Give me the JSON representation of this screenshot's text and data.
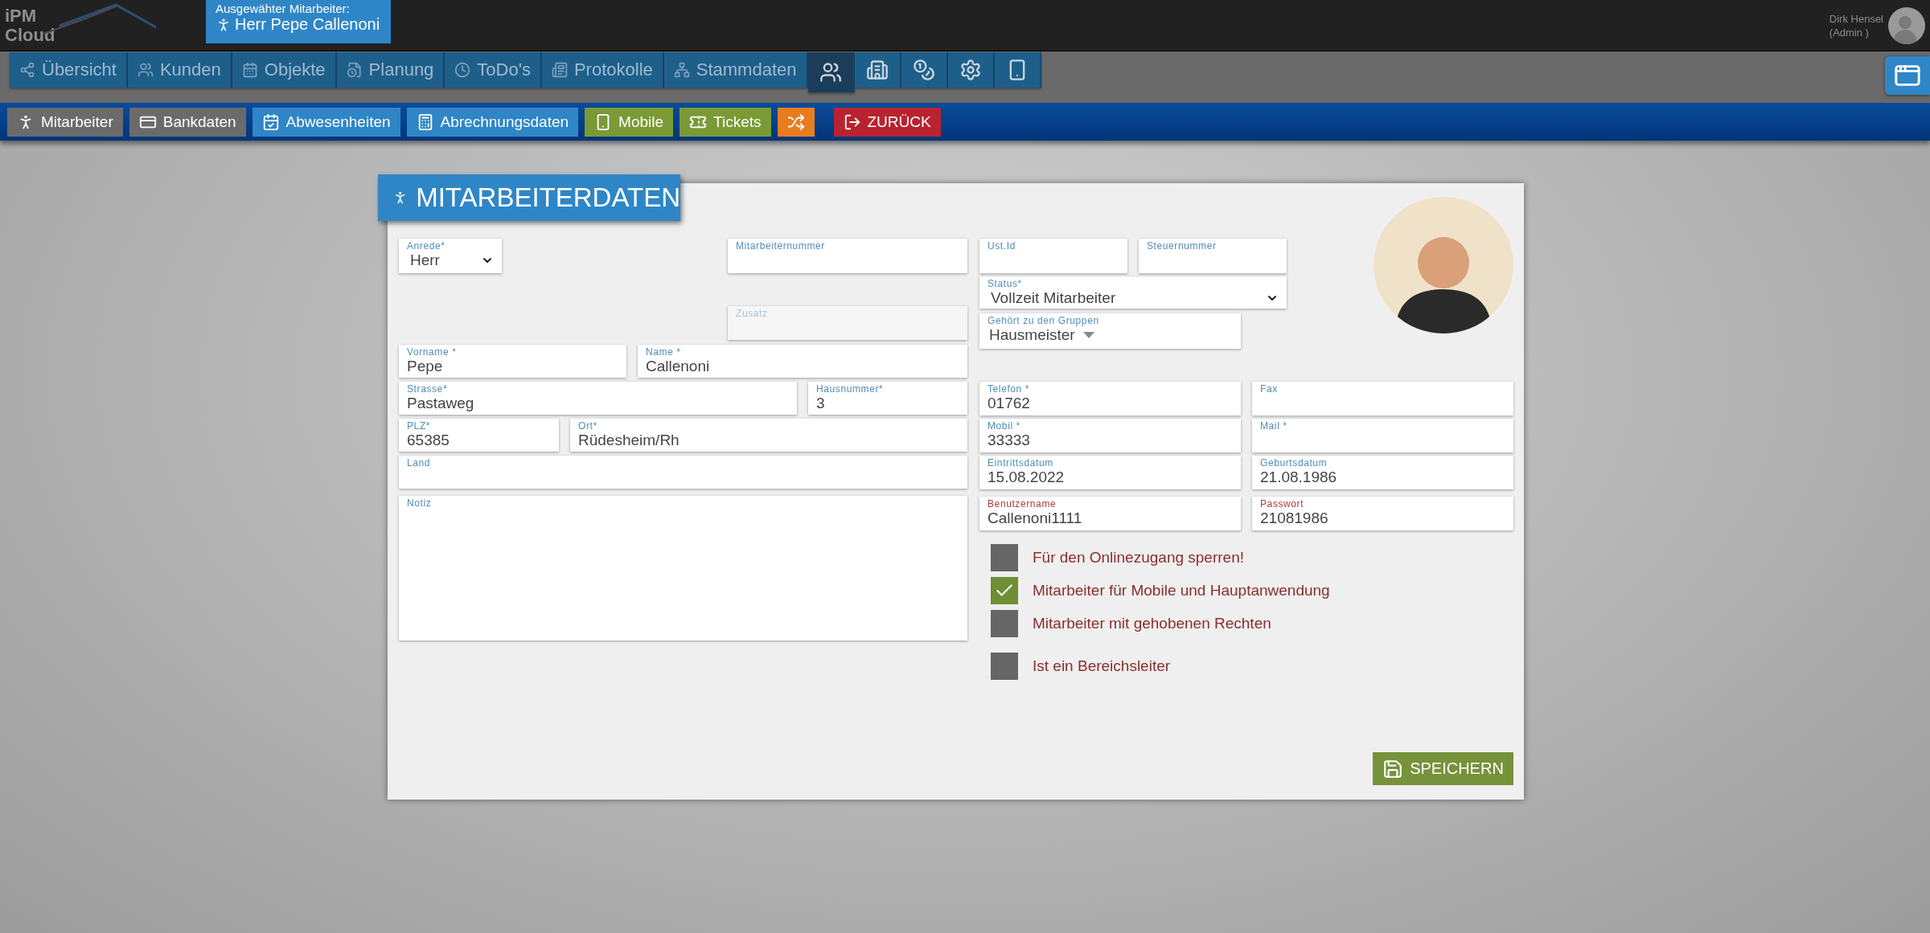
{
  "header": {
    "logo": {
      "line1": "iPM",
      "line2": "Cloud"
    },
    "selected_employee": {
      "label": "Ausgewähter Mitarbeiter:",
      "name": "Herr Pepe Callenoni"
    },
    "user": {
      "name": "Dirk Hensel",
      "role": "(Admin )"
    }
  },
  "nav_tabs": [
    {
      "label": "Übersicht",
      "selected": false
    },
    {
      "label": "Kunden",
      "selected": false
    },
    {
      "label": "Objekte",
      "selected": false
    },
    {
      "label": "Planung",
      "selected": false
    },
    {
      "label": "ToDo's",
      "selected": false
    },
    {
      "label": "Protokolle",
      "selected": false
    },
    {
      "label": "Stammdaten",
      "selected": false
    },
    {
      "selected": true
    },
    {
      "selected": false
    },
    {
      "selected": false
    },
    {
      "selected": false
    },
    {
      "selected": false
    }
  ],
  "sub_nav": [
    {
      "label": "Mitarbeiter",
      "color": "#6b6b6b",
      "kind": "tab"
    },
    {
      "label": "Bankdaten",
      "color": "#6b6b6b",
      "kind": "tab"
    },
    {
      "label": "Abwesenheiten",
      "color": "#2f86c7",
      "kind": "tab"
    },
    {
      "label": "Abrechnungsdaten",
      "color": "#2f86c7",
      "kind": "tab"
    },
    {
      "label": "Mobile",
      "color": "#7a9a35",
      "kind": "tab"
    },
    {
      "label": "Tickets",
      "color": "#7a9a35",
      "kind": "tab"
    },
    {
      "color": "#e87d1e",
      "kind": "tab"
    },
    {
      "label": "ZURÜCK",
      "color": "#b8232f",
      "kind": "back"
    }
  ],
  "form": {
    "title": "MITARBEITERDATEN",
    "left_top": {
      "anrede": {
        "label": "Anrede*",
        "value": "Herr",
        "kind": "select"
      },
      "mitarbeiternummer": {
        "label": "Mitarbeiternummer",
        "kind": "text"
      },
      "zusatz": {
        "label": "Zusatz",
        "kind": "text",
        "disabled": true
      }
    },
    "left_rows": [
      [
        {
          "label": "Vorname *",
          "value": "Pepe",
          "kind": "text"
        },
        {
          "label": "Name *",
          "value": "Callenoni",
          "kind": "text"
        }
      ],
      [
        {
          "label": "Strasse*",
          "value": "Pastaweg",
          "kind": "text"
        },
        {
          "label": "Hausnummer*",
          "value": "3",
          "kind": "text"
        }
      ],
      [
        {
          "label": "PLZ*",
          "value": "65385",
          "kind": "text"
        },
        {
          "label": "Ort*",
          "value": "Rüdesheim/Rh",
          "kind": "text"
        }
      ],
      [
        {
          "label": "Land",
          "kind": "text"
        }
      ]
    ],
    "notiz": {
      "label": "Notiz",
      "kind": "textarea"
    },
    "right_top": {
      "ust_id": {
        "label": "Ust.Id",
        "kind": "text"
      },
      "steuernummer": {
        "label": "Steuernummer",
        "kind": "text"
      },
      "status": {
        "label": "Status*",
        "value": "Vollzeit Mitarbeiter",
        "kind": "select"
      },
      "gruppen": {
        "label": "Gehört zu den Gruppen",
        "value": "Hausmeister",
        "kind": "dropdown"
      }
    },
    "right_rows": [
      [
        {
          "label": "Telefon *",
          "value": "01762",
          "kind": "text",
          "highlighted": false
        },
        {
          "label": "Fax",
          "kind": "text",
          "highlighted": false
        }
      ],
      [
        {
          "label": "Mobil *",
          "value": "33333",
          "kind": "text",
          "highlighted": false
        },
        {
          "label": "Mail *",
          "kind": "text",
          "highlighted": false
        }
      ],
      [
        {
          "label": "Eintrittsdatum",
          "value": "15.08.2022",
          "kind": "text",
          "highlighted": false
        },
        {
          "label": "Geburtsdatum",
          "value": "21.08.1986",
          "kind": "text",
          "highlighted": false
        }
      ],
      [
        {
          "label": "Benutzername",
          "value": "Callenoni1111",
          "kind": "text",
          "highlighted": true
        },
        {
          "label": "Passwort",
          "value": "21081986",
          "kind": "text",
          "highlighted": true
        }
      ]
    ],
    "options": [
      {
        "label": "Für den Onlinezugang sperren!",
        "checked": false
      },
      {
        "label": "Mitarbeiter für Mobile und Hauptanwendung",
        "checked": true
      },
      {
        "label": "Mitarbeiter mit gehobenen Rechten",
        "checked": false
      },
      {
        "label": "Ist ein Bereichsleiter",
        "checked": false
      }
    ],
    "save_button": {
      "label": "SPEICHERN"
    }
  }
}
